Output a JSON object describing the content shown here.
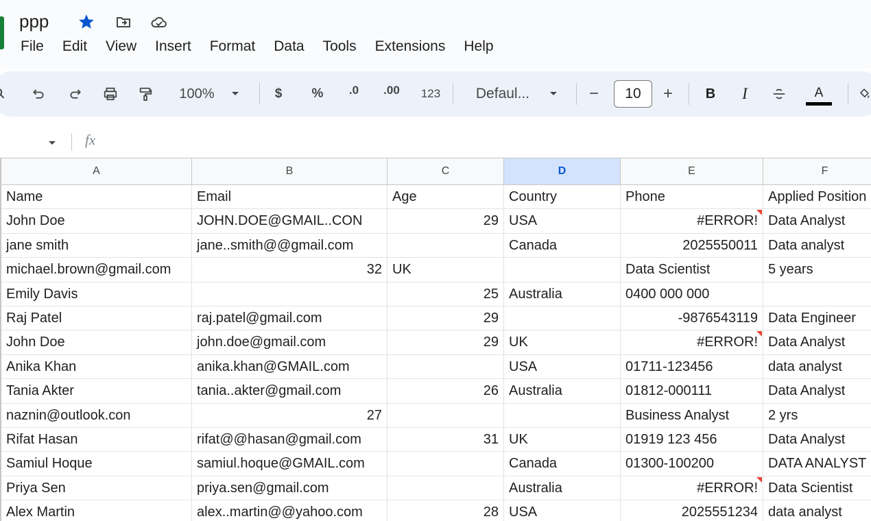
{
  "doc": {
    "title": "ppp"
  },
  "menu": [
    "File",
    "Edit",
    "View",
    "Insert",
    "Format",
    "Data",
    "Tools",
    "Extensions",
    "Help"
  ],
  "toolbar": {
    "zoom": "100%",
    "currency": "$",
    "percent": "%",
    "dec_decrease": ".0",
    "dec_increase": ".00",
    "number_format": "123",
    "font": "Defaul...",
    "font_size": "10",
    "minus": "−",
    "plus": "+",
    "bold": "B",
    "italic": "I",
    "text_color": "A"
  },
  "formula": {
    "fx": "fx"
  },
  "columns": [
    "A",
    "B",
    "C",
    "D",
    "E",
    "F"
  ],
  "selected_column": "D",
  "rows": [
    [
      "Name",
      "Email",
      "Age",
      "Country",
      "Phone",
      "Applied Position"
    ],
    [
      "John Doe",
      "JOHN.DOE@GMAIL..CON",
      "29",
      "USA",
      "#ERROR!",
      "Data Analyst"
    ],
    [
      "jane smith",
      "jane..smith@@gmail.com",
      "",
      "Canada",
      "2025550011",
      "Data analyst"
    ],
    [
      "michael.brown@gmail.com",
      "32",
      "UK",
      "",
      "Data Scientist",
      "5 years"
    ],
    [
      "Emily Davis",
      "",
      "25",
      "Australia",
      "0400 000 000",
      ""
    ],
    [
      "Raj Patel",
      "raj.patel@gmail.com",
      "29",
      "",
      "-9876543119",
      "Data Engineer"
    ],
    [
      "John Doe",
      "john.doe@gmail.com",
      "29",
      "UK",
      "#ERROR!",
      "Data Analyst"
    ],
    [
      "Anika Khan",
      "anika.khan@GMAIL.com",
      "",
      "USA",
      "01711-123456",
      "data analyst"
    ],
    [
      "Tania Akter",
      "tania..akter@gmail.com",
      "26",
      "Australia",
      "01812-000111",
      "Data Analyst"
    ],
    [
      "naznin@outlook.con",
      "27",
      "",
      "",
      "Business Analyst",
      "2 yrs"
    ],
    [
      "Rifat Hasan",
      "rifat@@hasan@gmail.com",
      "31",
      "UK",
      "01919 123 456",
      "Data Analyst"
    ],
    [
      "Samiul Hoque",
      "samiul.hoque@GMAIL.com",
      "",
      "Canada",
      "01300-100200",
      "DATA ANALYST"
    ],
    [
      "Priya Sen",
      "priya.sen@gmail.com",
      "",
      "Australia",
      "#ERROR!",
      "Data Scientist"
    ],
    [
      "Alex Martin",
      "alex..martin@@yahoo.com",
      "28",
      "USA",
      "2025551234",
      "data analyst"
    ]
  ],
  "colors": {
    "selected_header": "#d3e3fd",
    "error_triangle": "#ea4335",
    "star": "#0b57d0",
    "sheets_green": "#188038"
  }
}
